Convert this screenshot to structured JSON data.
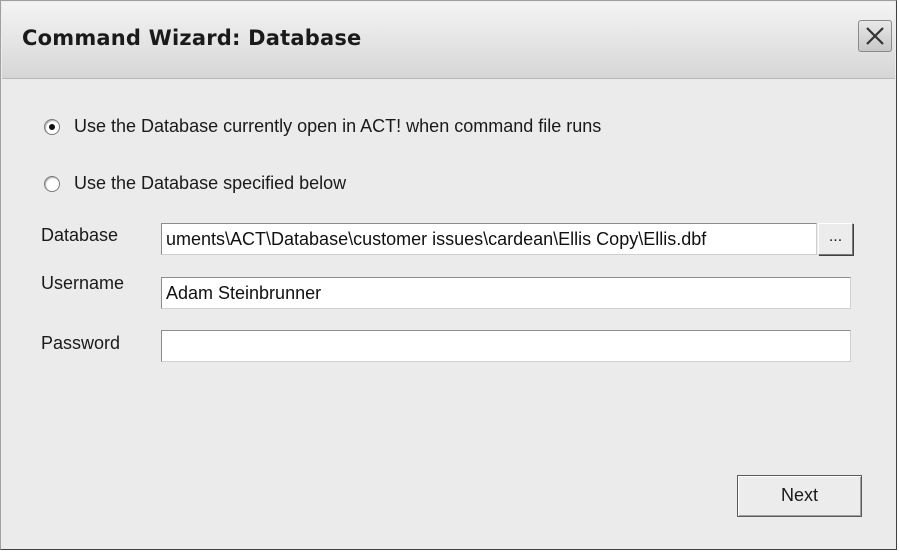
{
  "window": {
    "title": "Command Wizard: Database"
  },
  "options": {
    "use_current": {
      "label": "Use the Database currently open in ACT! when command file runs",
      "selected": true
    },
    "use_specified": {
      "label": "Use the Database specified below",
      "selected": false
    }
  },
  "fields": {
    "database": {
      "label": "Database",
      "value": "uments\\ACT\\Database\\customer issues\\cardean\\Ellis Copy\\Ellis.dbf"
    },
    "username": {
      "label": "Username",
      "value": "Adam Steinbrunner"
    },
    "password": {
      "label": "Password",
      "value": ""
    }
  },
  "buttons": {
    "browse_label": "...",
    "next_label": "Next"
  },
  "icons": {
    "close": "close-icon"
  }
}
